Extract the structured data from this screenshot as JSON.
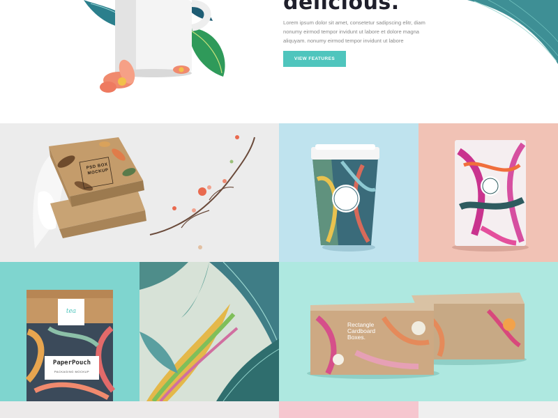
{
  "hero": {
    "title": "delicious.",
    "body": "Lorem ipsum dolor sit amet, consetetur sadipscing elitr, diam nonumy eirmod tempor invidunt ut labore et dolore magna aliquyam. nonumy eirmod tempor invidunt ut labore",
    "cta_label": "VIEW FEATURES"
  },
  "gallery": {
    "box_mockup": {
      "label_line1": "PSD BOX",
      "label_line2": "MOCKUP"
    },
    "paper_pouch": {
      "brand": "PaperPouch",
      "subtitle": "PACKAGING MOCKUP",
      "badge": "tea"
    },
    "boxes": {
      "label_line1": "Rectangle",
      "label_line2": "Cardboard",
      "label_line3": "Boxes."
    }
  },
  "colors": {
    "accent": "#4fc5bd",
    "heading": "#1f1f2b",
    "tile_cup_bg": "#bfe3ee",
    "tile_pouch_bg": "#f1c2b5",
    "tile_teal_bg": "#7fd5cf",
    "tile_mint_bg": "#aee8e0",
    "strip_pink": "#f6c6cf"
  }
}
